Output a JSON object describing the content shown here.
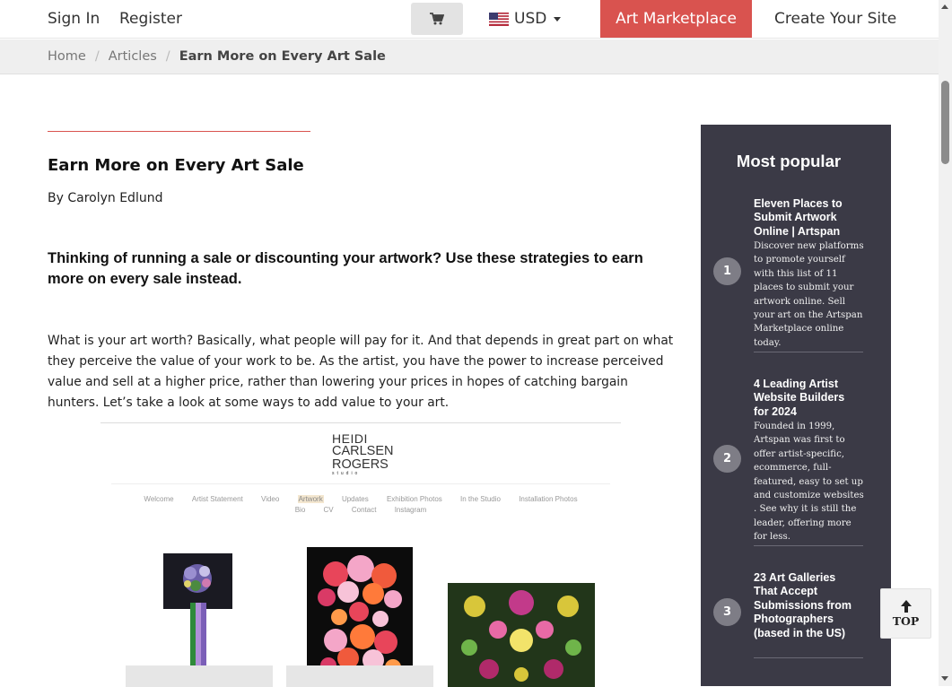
{
  "nav": {
    "sign_in": "Sign In",
    "register": "Register",
    "cart_icon": "shopping-cart-icon",
    "currency": "USD",
    "flag_icon": "us-flag-icon",
    "marketplace": "Art Marketplace",
    "create_site": "Create Your Site"
  },
  "breadcrumb": {
    "home": "Home",
    "articles": "Articles",
    "current": "Earn More on Every Art Sale"
  },
  "article": {
    "title": "Earn More on Every Art Sale",
    "author": "By Carolyn Edlund",
    "lede": "Thinking of running a sale or discounting your artwork? Use these strategies to earn more on every sale instead.",
    "paragraph": "What is your art worth? Basically, what people will pay for it. And that depends in great part on what they perceive the value of your work to be. As the artist, you have the power to increase perceived value and sell at a higher price, rather than lowering your prices in hopes of catching bargain hunters. Let’s take a look at some ways to add value to your art."
  },
  "figure": {
    "logo": {
      "line1": "HEIDI",
      "line2": "CARLSEN",
      "line3": "ROGERS",
      "line4": "studio"
    },
    "nav_row1": [
      "Welcome",
      "Artist Statement",
      "Video",
      "Artwork",
      "Updates",
      "Exhibition Photos",
      "In the Studio",
      "Installation Photos"
    ],
    "nav_row2": [
      "Bio",
      "CV",
      "Contact",
      "Instagram"
    ],
    "active_item": "Artwork"
  },
  "sidebar": {
    "heading": "Most popular",
    "items": [
      {
        "num": "1",
        "title": "Eleven Places to Submit Artwork Online | Artspan",
        "desc": "Discover new platforms to promote yourself with this list of 11 places to submit your artwork online. Sell your art on the Artspan Marketplace online today."
      },
      {
        "num": "2",
        "title": "4 Leading Artist Website Builders for 2024",
        "desc": "Founded in 1999, Artspan was first to offer artist-specific, ecommerce, full-featured, easy to set up and customize websites . See why it is still the leader, offering more for less."
      },
      {
        "num": "3",
        "title": "23 Art Galleries That Accept Submissions from Photographers (based in the US)",
        "desc": ""
      }
    ]
  },
  "top_button": {
    "label": "TOP",
    "icon": "arrow-up-icon"
  },
  "colors": {
    "accent": "#d9534f",
    "sidebar_bg": "#3b3a46",
    "badge": "#7e7d86"
  }
}
